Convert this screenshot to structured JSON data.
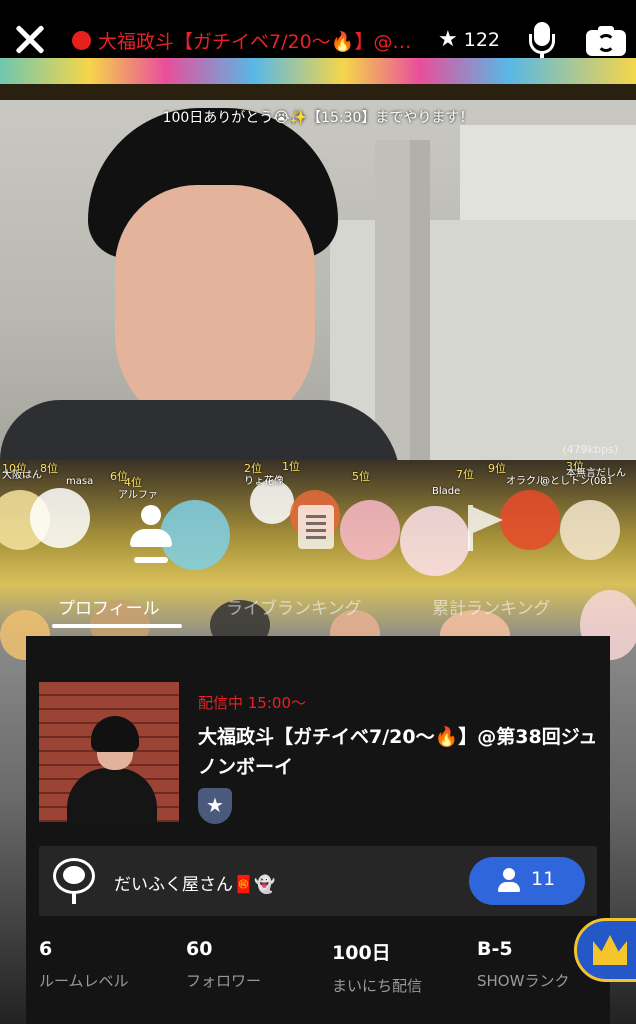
{
  "header": {
    "stream_title": "大福政斗【ガチイベ7/20〜🔥】@第38回ジュノンボーイ",
    "star_count": "122"
  },
  "video": {
    "caption": "100日ありがとう😭✨【15:30】までやります！",
    "bitrate": "(479kbps)"
  },
  "avatar_overlay_labels": [
    "10位",
    "8位",
    "大阪はん",
    "masa",
    "6位",
    "4位",
    "アルファ",
    "2位",
    "1位",
    "りょ花像",
    "5位",
    "Blade",
    "7位",
    "9位",
    "3位",
    "本無言だしん",
    "オラクル",
    "@としトン(081"
  ],
  "tabs": [
    {
      "label": "プロフィール",
      "active": true
    },
    {
      "label": "ライブランキング",
      "active": false
    },
    {
      "label": "累計ランキング",
      "active": false
    }
  ],
  "profile": {
    "on_air": "配信中 15:00〜",
    "room_title": "大福政斗【ガチイベ7/20〜🔥】@第38回ジュノンボーイ",
    "owner_name": "だいふく屋さん🧧👻",
    "follow_count": "11",
    "stats": [
      {
        "value": "6",
        "label": "ルームレベル"
      },
      {
        "value": "60",
        "label": "フォロワー"
      },
      {
        "value": "100日",
        "label": "まいにち配信"
      },
      {
        "value": "B-5",
        "label": "SHOWランク"
      }
    ]
  },
  "colors": {
    "live_red": "#e82027",
    "accent_blue": "#2f66dc",
    "panel_bg": "#141414"
  }
}
